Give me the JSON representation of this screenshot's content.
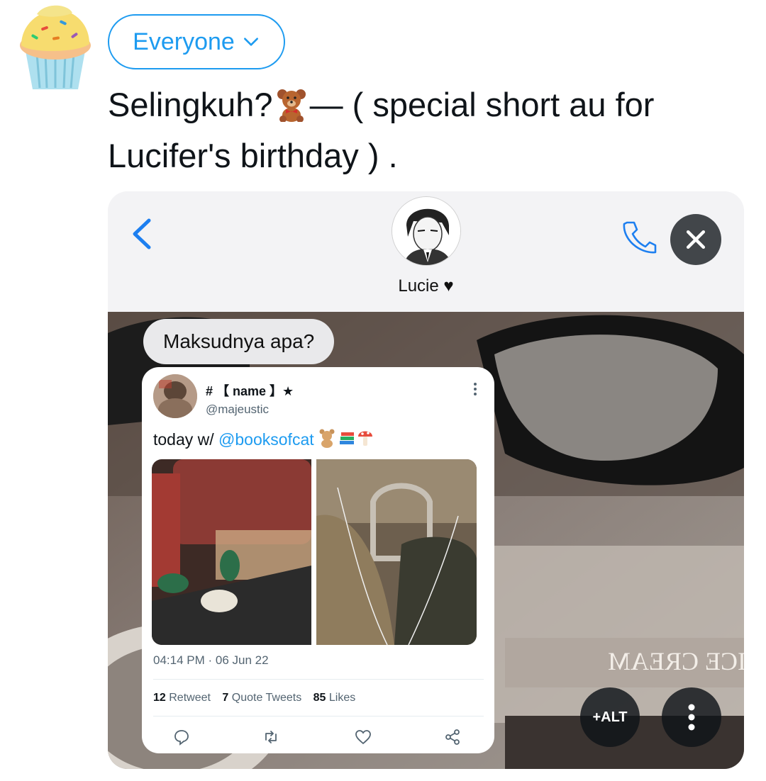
{
  "compose": {
    "audience_label": "Everyone",
    "tweet_line1": "Selingkuh?",
    "tweet_after_emoji": "— ( special short au for",
    "tweet_line2": "Lucifer's birthday ) ."
  },
  "media": {
    "chat": {
      "contact_name": "Lucie ♥",
      "message": "Maksudnya apa?"
    },
    "embedded_tweet": {
      "display_name": "# 【 name 】★",
      "handle": "@majeustic",
      "text_prefix": "today w/ ",
      "mention": "@booksofcat",
      "timestamp": "04:14 PM · 06 Jun 22",
      "stats": {
        "retweet_count": "12",
        "retweet_label": "Retweet",
        "quote_count": "7",
        "quote_label": "Quote Tweets",
        "likes_count": "85",
        "likes_label": "Likes"
      }
    },
    "alt_label": "+ALT"
  },
  "icons": {
    "avatar": "cupcake-icon",
    "audience_chevron": "chevron-down-icon",
    "inline_emoji": "teddy-bear-icon",
    "back": "chevron-left-icon",
    "call": "phone-icon",
    "close": "close-icon",
    "more": "more-vertical-icon"
  },
  "colors": {
    "accent": "#1d9bf0",
    "text": "#0f1419",
    "secondary_text": "#536471",
    "chat_header_bg": "#f3f3f5",
    "bubble_bg": "#e9e9eb"
  }
}
